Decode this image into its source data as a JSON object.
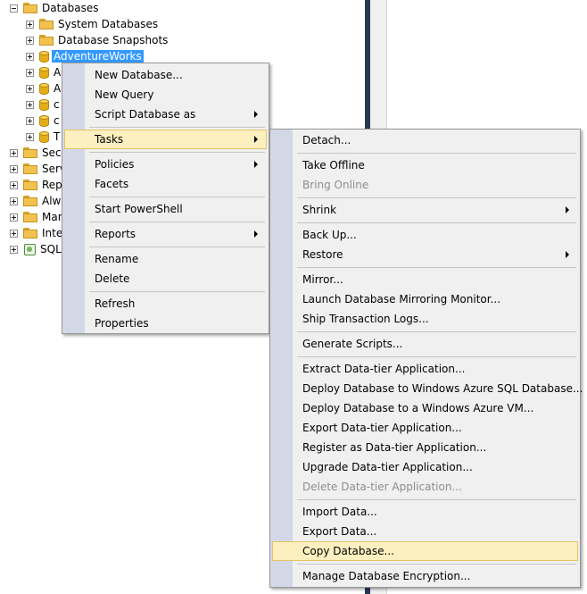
{
  "tree": {
    "databases_label": "Databases",
    "system_databases": "System Databases",
    "database_snapshots": "Database Snapshots",
    "selected_db": "AdventureWorks",
    "db_partials": [
      "A",
      "A",
      "c",
      "c",
      "T"
    ],
    "server_partials": [
      "Secu",
      "Serv",
      "Repl",
      "Alwa",
      "Man",
      "Integ",
      "SQL"
    ]
  },
  "context_menu": {
    "items": [
      {
        "label": "New Database..."
      },
      {
        "label": "New Query"
      },
      {
        "label": "Script Database as",
        "submenu": true
      },
      {
        "label": "Tasks",
        "submenu": true,
        "highlighted": true
      },
      {
        "label": "Policies",
        "submenu": true
      },
      {
        "label": "Facets"
      },
      {
        "label": "Start PowerShell"
      },
      {
        "label": "Reports",
        "submenu": true
      },
      {
        "label": "Rename"
      },
      {
        "label": "Delete"
      },
      {
        "label": "Refresh"
      },
      {
        "label": "Properties"
      }
    ]
  },
  "tasks_menu": {
    "items": [
      {
        "label": "Detach..."
      },
      {
        "label": "Take Offline"
      },
      {
        "label": "Bring Online",
        "disabled": true
      },
      {
        "label": "Shrink",
        "submenu": true
      },
      {
        "label": "Back Up..."
      },
      {
        "label": "Restore",
        "submenu": true
      },
      {
        "label": "Mirror..."
      },
      {
        "label": "Launch Database Mirroring Monitor..."
      },
      {
        "label": "Ship Transaction Logs..."
      },
      {
        "label": "Generate Scripts..."
      },
      {
        "label": "Extract Data-tier Application..."
      },
      {
        "label": "Deploy Database to Windows Azure SQL Database..."
      },
      {
        "label": "Deploy Database to a Windows Azure VM..."
      },
      {
        "label": "Export Data-tier Application..."
      },
      {
        "label": "Register as Data-tier Application..."
      },
      {
        "label": "Upgrade Data-tier Application..."
      },
      {
        "label": "Delete Data-tier Application...",
        "disabled": true
      },
      {
        "label": "Import Data..."
      },
      {
        "label": "Export Data..."
      },
      {
        "label": "Copy Database...",
        "highlighted": true
      },
      {
        "label": "Manage Database Encryption..."
      }
    ]
  },
  "colors": {
    "selection": "#3399ff",
    "menu_highlight": "#fcf0c0",
    "menu_highlight_border": "#e5c365",
    "menu_gutter": "#d2d8e6",
    "divider_bar": "#293955"
  }
}
